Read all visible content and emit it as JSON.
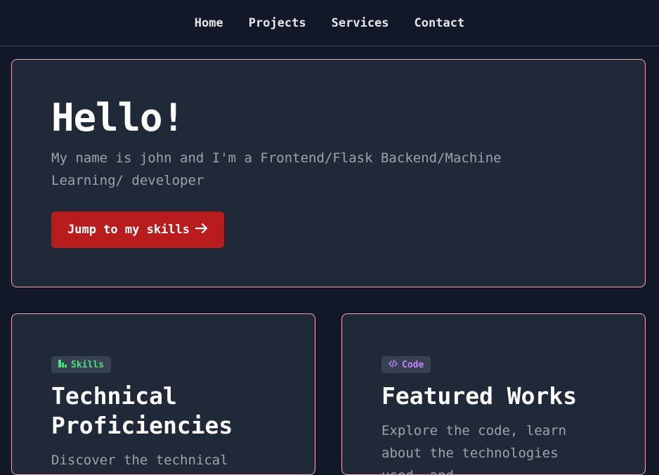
{
  "nav": {
    "items": [
      {
        "label": "Home"
      },
      {
        "label": "Projects"
      },
      {
        "label": "Services"
      },
      {
        "label": "Contact"
      }
    ]
  },
  "hero": {
    "title": "Hello!",
    "subtitle": "My name is john and I'm a Frontend/Flask Backend/Machine Learning/ developer",
    "button_label": "Jump to my skills",
    "button_icon": "arrow-right-icon"
  },
  "cards": [
    {
      "tag": "Skills",
      "tag_icon": "chart-icon",
      "tag_color": "#4ade80",
      "title": "Technical Proficiencies",
      "text": "Discover the technical"
    },
    {
      "tag": "Code",
      "tag_icon": "code-icon",
      "tag_color": "#c084fc",
      "title": "Featured Works",
      "text": "Explore the code, learn about the technologies used, and"
    }
  ],
  "colors": {
    "background": "#111827",
    "card": "#1f2937",
    "border": "#f9a8b8",
    "button": "#b91c1c"
  }
}
